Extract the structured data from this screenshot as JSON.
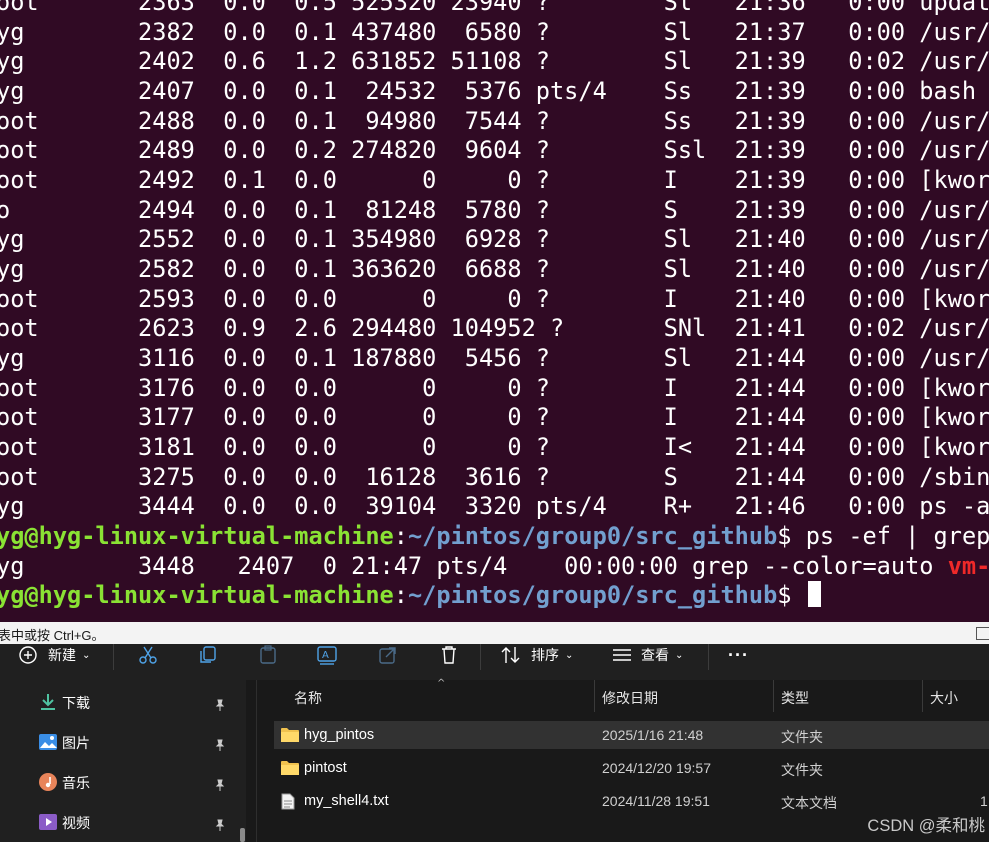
{
  "terminal": {
    "process_rows": [
      "oot       2363  0.0  0.5 525320 23940 ?        Sl   21:36   0:00 updat",
      "yg        2382  0.0  0.1 437480  6580 ?        Sl   21:37   0:00 /usr/",
      "yg        2402  0.6  1.2 631852 51108 ?        Sl   21:39   0:02 /usr/",
      "yg        2407  0.0  0.1  24532  5376 pts/4    Ss   21:39   0:00 bash",
      "oot       2488  0.0  0.1  94980  7544 ?        Ss   21:39   0:00 /usr/",
      "oot       2489  0.0  0.2 274820  9604 ?        Ssl  21:39   0:00 /usr/",
      "oot       2492  0.1  0.0      0     0 ?        I    21:39   0:00 [kwor",
      "o         2494  0.0  0.1  81248  5780 ?        S    21:39   0:00 /usr/",
      "yg        2552  0.0  0.1 354980  6928 ?        Sl   21:40   0:00 /usr/",
      "yg        2582  0.0  0.1 363620  6688 ?        Sl   21:40   0:00 /usr/",
      "oot       2593  0.0  0.0      0     0 ?        I    21:40   0:00 [kwor",
      "oot       2623  0.9  2.6 294480 104952 ?       SNl  21:41   0:02 /usr/",
      "yg        3116  0.0  0.1 187880  5456 ?        Sl   21:44   0:00 /usr/",
      "oot       3176  0.0  0.0      0     0 ?        I    21:44   0:00 [kwor",
      "oot       3177  0.0  0.0      0     0 ?        I    21:44   0:00 [kwor",
      "oot       3181  0.0  0.0      0     0 ?        I<   21:44   0:00 [kwor",
      "oot       3275  0.0  0.0  16128  3616 ?        S    21:44   0:00 /sbin",
      "yg        3444  0.0  0.0  39104  3320 pts/4    R+   21:46   0:00 ps -a"
    ],
    "prompt1": {
      "user_host": "yg@hyg-linux-virtual-machine",
      "colon": ":",
      "path": "~/pintos/group0/src_github",
      "dollar": "$",
      "command": " ps -ef | grep"
    },
    "grep_line": {
      "text": "yg        3448   2407  0 21:47 pts/4    00:00:00 grep --color=auto ",
      "match": "vm-"
    },
    "prompt2": {
      "user_host": "yg@hyg-linux-virtual-machine",
      "colon": ":",
      "path": "~/pintos/group0/src_github",
      "dollar": "$ "
    }
  },
  "statusbar": {
    "text": "表中或按 Ctrl+G。"
  },
  "toolbar": {
    "new_label": "新建",
    "sort_label": "排序",
    "view_label": "查看",
    "more_label": "···"
  },
  "sidebar": {
    "items": [
      {
        "label": "下载",
        "icon": "download-icon"
      },
      {
        "label": "图片",
        "icon": "pictures-icon"
      },
      {
        "label": "音乐",
        "icon": "music-icon"
      },
      {
        "label": "视频",
        "icon": "video-icon"
      }
    ]
  },
  "filelist": {
    "columns": {
      "name": "名称",
      "date": "修改日期",
      "type": "类型",
      "size": "大小"
    },
    "rows": [
      {
        "name": "hyg_pintos",
        "date": "2025/1/16 21:48",
        "type": "文件夹",
        "size": "",
        "kind": "folder",
        "selected": true
      },
      {
        "name": "pintost",
        "date": "2024/12/20 19:57",
        "type": "文件夹",
        "size": "",
        "kind": "folder",
        "selected": false
      },
      {
        "name": "my_shell4.txt",
        "date": "2024/11/28 19:51",
        "type": "文本文档",
        "size": "1",
        "kind": "file",
        "selected": false
      }
    ]
  },
  "watermark": "CSDN @柔和桃",
  "colors": {
    "terminal_bg": "#300a24",
    "prompt_user": "#8ae234",
    "prompt_path": "#729fcf",
    "grep_match": "#ef2929",
    "explorer_bg": "#191919",
    "folder": "#f0c24f"
  }
}
